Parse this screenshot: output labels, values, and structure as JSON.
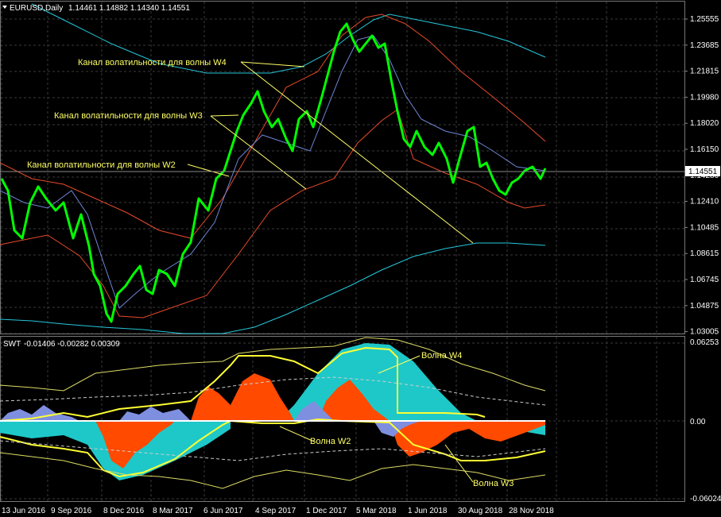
{
  "main_header": {
    "arrow": "dropdown-arrow-icon",
    "symbol": "EURUSD,Daily",
    "values": "1.14461 1.14882 1.14340 1.14551"
  },
  "current_price": "1.14551",
  "price_axis": [
    "1.25555",
    "1.23685",
    "1.21815",
    "1.19980",
    "1.18020",
    "1.16150",
    "1.14280",
    "1.12410",
    "1.10485",
    "1.08615",
    "1.06745",
    "1.04875",
    "1.03005"
  ],
  "date_axis": [
    "13 Jun 2016",
    "9 Sep 2016",
    "8 Dec 2016",
    "8 Mar 2017",
    "6 Jun 2017",
    "4 Sep 2017",
    "1 Dec 2017",
    "5 Mar 2018",
    "1 Jun 2018",
    "30 Aug 2018",
    "28 Nov 2018"
  ],
  "annotations": {
    "w4": "Канал волатильности для волны W4",
    "w3": "Канал волатильности для волны W3",
    "w2": "Канал волатильности для волны W2"
  },
  "sub_header": {
    "name": "SWT",
    "values": "-0.01406 -0.00282 0.00309"
  },
  "sub_axis": [
    "0.06253",
    "0.00",
    "-0.06024"
  ],
  "sub_annotations": {
    "w4": "Волна W4",
    "w2": "Волна W2",
    "w3": "Волна W3"
  },
  "colors": {
    "background": "#000000",
    "grid": "#3a3a3a",
    "candles": "#00ff00",
    "cyan_band": "#26c6da",
    "red_band": "#e84a2a",
    "blue_line": "#6f86d6",
    "annotation": "#ffff66",
    "osc_cyan": "#1ec8c8",
    "osc_orange": "#ff4a00",
    "osc_blue": "#7f8fe0",
    "osc_yellow": "#ffff33"
  }
}
